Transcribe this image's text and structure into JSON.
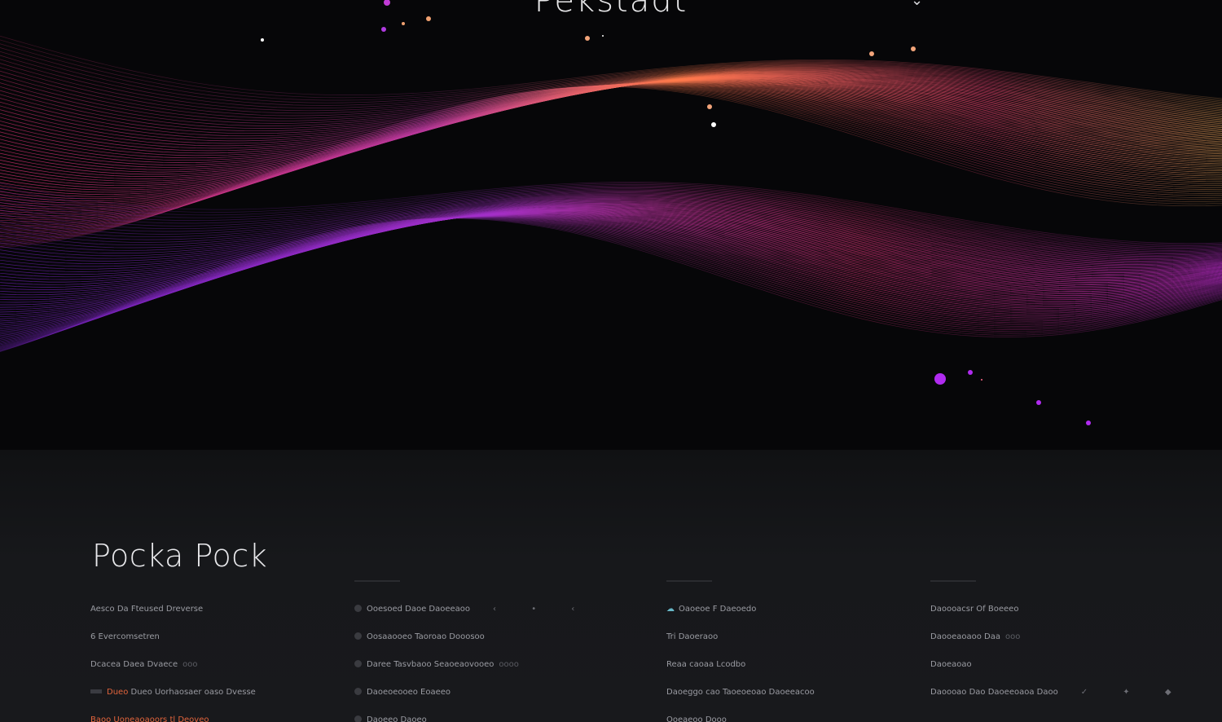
{
  "hero": {
    "title": "Pekstadt",
    "chevron": "⌄"
  },
  "footer": {
    "brand": "Pocka Pock",
    "col1": {
      "items": [
        {
          "label": "Aesco Da Fteused Dreverse"
        },
        {
          "label": "6 Evercomsetren"
        },
        {
          "label": "Dcacea Daea Dvaece",
          "extra": "ooo"
        },
        {
          "label": "Dueo Uorhaosaer oaso Dvesse",
          "accent": "Dueo"
        },
        {
          "label": "Baoo Uoneaoaoors tl Deoveo",
          "accent": "Baoo"
        }
      ]
    },
    "col2": {
      "items": [
        {
          "label": "Ooesoed Daoe Daoeeaoo",
          "icons": "‹ • ‹"
        },
        {
          "label": "Oosaaooeo Taoroao Dooosoo"
        },
        {
          "label": "Daree Tasvbaoo Seaoeaovooeo",
          "extra": "oooo"
        },
        {
          "label": "Daoeoeooeo Eoaeeo"
        },
        {
          "label": "Daoeeo Daoeo"
        }
      ]
    },
    "col3": {
      "items": [
        {
          "label": "Oaoeoe F Daeoedo",
          "icon": "cloud"
        },
        {
          "label": "Tri Daoeraoo"
        },
        {
          "label": "Reaa caoaa Lcodbo"
        },
        {
          "label": "Daoeggo cao Taoeoeoao Daoeeacoo"
        },
        {
          "label": "Ooeaeoo Dooo"
        }
      ]
    },
    "col4": {
      "items": [
        {
          "label": "Daoooacsr Of Boeeeo"
        },
        {
          "label": "Daooeaoaoo Daa",
          "extra": "ooo"
        },
        {
          "label": "Daoeaoao"
        },
        {
          "label": "Daoooao Dao Daoeeoaoa Daoo",
          "icons": "✓ ✦ ◆"
        }
      ]
    }
  },
  "colors": {
    "bg_hero": "#060608",
    "bg_footer": "#17181b",
    "accent": "#e2643c",
    "wave_orange": "#f2a45a",
    "wave_pink": "#ff3c8a",
    "wave_purple": "#8c2be6"
  }
}
